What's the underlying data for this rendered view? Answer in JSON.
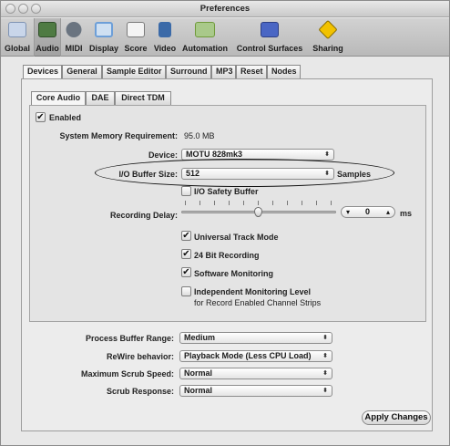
{
  "window": {
    "title": "Preferences"
  },
  "toolbar": {
    "items": [
      {
        "label": "Global",
        "icon": "global-icon",
        "color": "#9bb3d6"
      },
      {
        "label": "Audio",
        "icon": "audio-icon",
        "color": "#4f7b43"
      },
      {
        "label": "MIDI",
        "icon": "midi-icon",
        "color": "#5e6a75"
      },
      {
        "label": "Display",
        "icon": "display-icon",
        "color": "#6d9fd8"
      },
      {
        "label": "Score",
        "icon": "score-icon",
        "color": "#8b8b8b"
      },
      {
        "label": "Video",
        "icon": "video-icon",
        "color": "#3b6aa8"
      },
      {
        "label": "Automation",
        "icon": "automation-icon",
        "color": "#6f9a3a"
      },
      {
        "label": "Control Surfaces",
        "icon": "control-surfaces-icon",
        "color": "#4a66c4"
      },
      {
        "label": "Sharing",
        "icon": "sharing-icon",
        "color": "#e8b800"
      }
    ],
    "selected": "Audio"
  },
  "main_tabs": [
    "Devices",
    "General",
    "Sample Editor",
    "Surround",
    "MP3",
    "Reset",
    "Nodes"
  ],
  "sub_tabs": [
    "Core Audio",
    "DAE",
    "Direct TDM"
  ],
  "core_audio": {
    "enabled_label": "Enabled",
    "enabled_checked": true,
    "memory_label": "System Memory Requirement:",
    "memory_value": "95.0 MB",
    "device_label": "Device:",
    "device_value": "MOTU 828mk3",
    "buffer_label": "I/O Buffer Size:",
    "buffer_value": "512",
    "buffer_unit": "Samples",
    "safety_label": "I/O Safety Buffer",
    "safety_checked": false,
    "delay_label": "Recording Delay:",
    "delay_value": "0",
    "delay_unit": "ms",
    "options": [
      {
        "label": "Universal Track Mode",
        "checked": true
      },
      {
        "label": "24 Bit Recording",
        "checked": true
      },
      {
        "label": "Software Monitoring",
        "checked": true
      },
      {
        "label": "Independent Monitoring Level",
        "checked": false
      }
    ],
    "independent_sub": "for Record Enabled Channel Strips"
  },
  "bottom": {
    "process_label": "Process Buffer Range:",
    "process_value": "Medium",
    "rewire_label": "ReWire behavior:",
    "rewire_value": "Playback Mode (Less CPU Load)",
    "scrub_speed_label": "Maximum Scrub Speed:",
    "scrub_speed_value": "Normal",
    "scrub_response_label": "Scrub Response:",
    "scrub_response_value": "Normal"
  },
  "apply_label": "Apply Changes",
  "glyphs": {
    "check": "✔",
    "updown": "⬍",
    "down": "▾",
    "up": "▴"
  }
}
